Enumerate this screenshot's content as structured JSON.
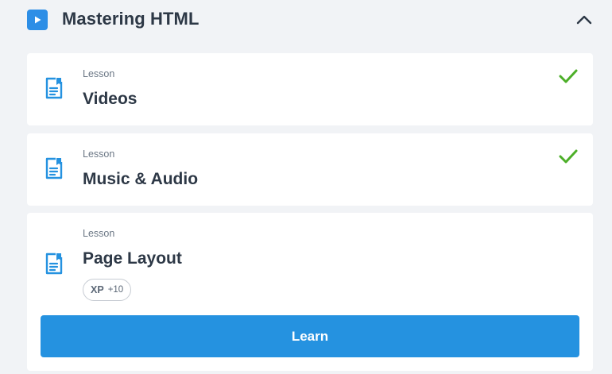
{
  "module": {
    "title": "Mastering HTML",
    "play_icon": "play-icon",
    "collapse_icon": "chevron-up-icon"
  },
  "lessons": [
    {
      "type": "Lesson",
      "title": "Videos",
      "completed": true,
      "icon": "lesson-document-icon"
    },
    {
      "type": "Lesson",
      "title": "Music & Audio",
      "completed": true,
      "icon": "lesson-document-icon"
    },
    {
      "type": "Lesson",
      "title": "Page Layout",
      "completed": false,
      "icon": "lesson-document-icon",
      "xp": {
        "label": "XP",
        "value": "+10"
      },
      "action_label": "Learn"
    }
  ],
  "colors": {
    "accent": "#2592e0",
    "check": "#4caf28",
    "background": "#f1f3f6"
  }
}
